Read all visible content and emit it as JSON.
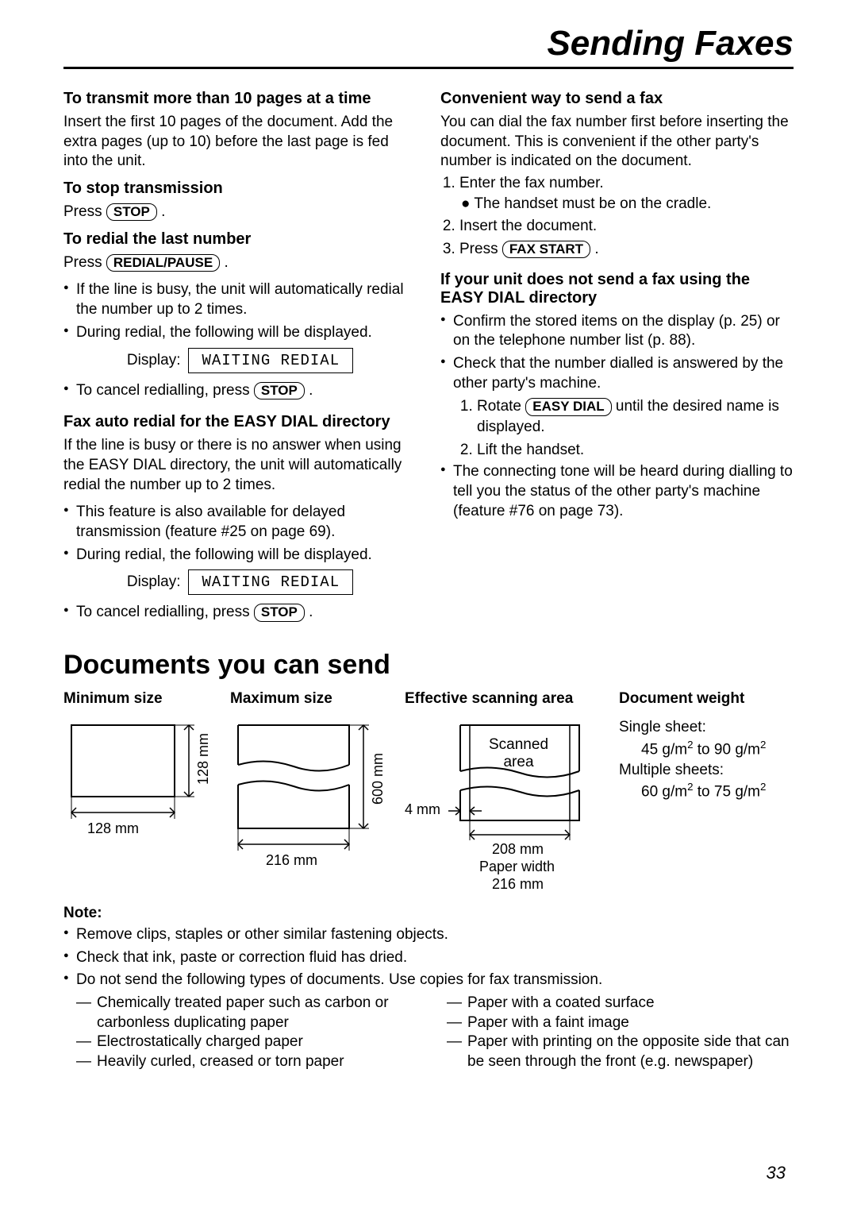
{
  "page_title": "Sending Faxes",
  "page_number": "33",
  "left": {
    "h_transmit": "To transmit more than 10 pages at a time",
    "p_transmit": "Insert the first 10 pages of the document. Add the extra pages (up to 10) before the last page is fed into the unit.",
    "h_stop": "To stop transmission",
    "press_word": "Press",
    "stop_btn": "STOP",
    "h_redial": "To redial the last number",
    "redial_btn": "REDIAL/PAUSE",
    "redial_b1": "If the line is busy, the unit will automatically redial the number up to 2 times.",
    "redial_b2": "During redial, the following will be displayed.",
    "display_label": "Display:",
    "display_value": "WAITING REDIAL",
    "redial_cancel_prefix": "To cancel redialling, press ",
    "h_auto": "Fax auto redial for the EASY DIAL directory",
    "p_auto": "If the line is busy or there is no answer when using the EASY DIAL directory, the unit will automatically redial the number up to 2 times.",
    "auto_b1": "This feature is also available for delayed transmission (feature #25 on page 69).",
    "auto_b2": "During redial, the following will be displayed."
  },
  "right": {
    "h_conv": "Convenient way to send a fax",
    "p_conv": "You can dial the fax number first before inserting the document. This is convenient if the other party's number is indicated on the document.",
    "conv_o1": "Enter the fax number.",
    "conv_o1_sub": "● The handset must be on the cradle.",
    "conv_o2": "Insert the document.",
    "conv_o3_prefix": "Press ",
    "fax_start_btn": "FAX START",
    "h_easy": "If your unit does not send a fax using the EASY DIAL directory",
    "easy_b1": "Confirm the stored items on the display (p. 25) or on the telephone number list (p. 88).",
    "easy_b2": "Check that the number dialled is answered by the other party's machine.",
    "easy_o1_prefix": "Rotate ",
    "easy_dial_btn": "EASY DIAL",
    "easy_o1_suffix": " until the desired name is displayed.",
    "easy_o2": "Lift the handset.",
    "easy_b3": "The connecting tone will be heard during dialling to tell you the status of the other party's machine (feature #76 on page 73)."
  },
  "docs": {
    "title": "Documents you can send",
    "h_min": "Minimum size",
    "h_max": "Maximum size",
    "h_eff": "Effective scanning area",
    "h_weight": "Document weight",
    "min_w": "128 mm",
    "min_h": "128 mm",
    "max_w": "216 mm",
    "max_h": "600 mm",
    "eff_margin": "4 mm",
    "eff_scan_w": "208 mm",
    "eff_paper_w_label": "Paper width",
    "eff_paper_w": "216 mm",
    "scanned_area": "Scanned\narea",
    "weight_single_label": "Single sheet:",
    "weight_single_val": "45 g/m² to 90 g/m²",
    "weight_multi_label": "Multiple sheets:",
    "weight_multi_val": "60 g/m² to 75 g/m²"
  },
  "note": {
    "head": "Note:",
    "b1": "Remove clips, staples or other similar fastening objects.",
    "b2": "Check that ink, paste or correction fluid has dried.",
    "b3": "Do not send the following types of documents. Use copies for fax transmission.",
    "d1": "Chemically treated paper such as carbon or carbonless duplicating paper",
    "d2": "Electrostatically charged paper",
    "d3": "Heavily curled, creased or torn paper",
    "d4": "Paper with a coated surface",
    "d5": "Paper with a faint image",
    "d6": "Paper with printing on the opposite side that can be seen through the front (e.g. newspaper)"
  }
}
